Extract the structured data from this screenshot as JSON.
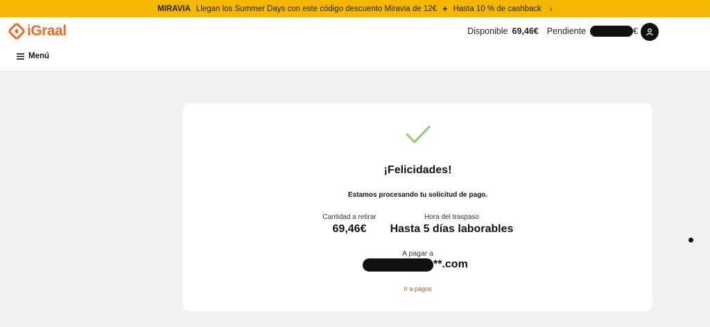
{
  "promo": {
    "brand": "MIRAVIA",
    "message": "Llegan los Summer Days con este código descuento Miravia de 12€",
    "plus": "+",
    "cashback": "Hasta 10 % de cashback",
    "chevron": "›"
  },
  "header": {
    "logo_text": "iGraal",
    "available_label": "Disponible",
    "available_value": "69,46€",
    "pending_label": "Pendiente",
    "pending_currency": "€",
    "menu_label": "Menú"
  },
  "confirmation": {
    "title": "¡Felicidades!",
    "subtitle": "Estamos procesando tu solicitud de pago.",
    "amount_label": "Cantidad a retirar",
    "amount_value": "69,46€",
    "time_label": "Hora del traspaso",
    "time_value": "Hasta 5 días laborables",
    "pay_label": "A pagar a",
    "pay_suffix": "**.com",
    "link": "Ir a pagos"
  },
  "colors": {
    "promo_bg": "#f5b800",
    "brand_orange": "#f26a21",
    "check_green": "#8ccf6a",
    "link_color": "#b5561c"
  },
  "icons": [
    "logo-icon",
    "hamburger-icon",
    "user-icon",
    "checkmark-icon"
  ]
}
